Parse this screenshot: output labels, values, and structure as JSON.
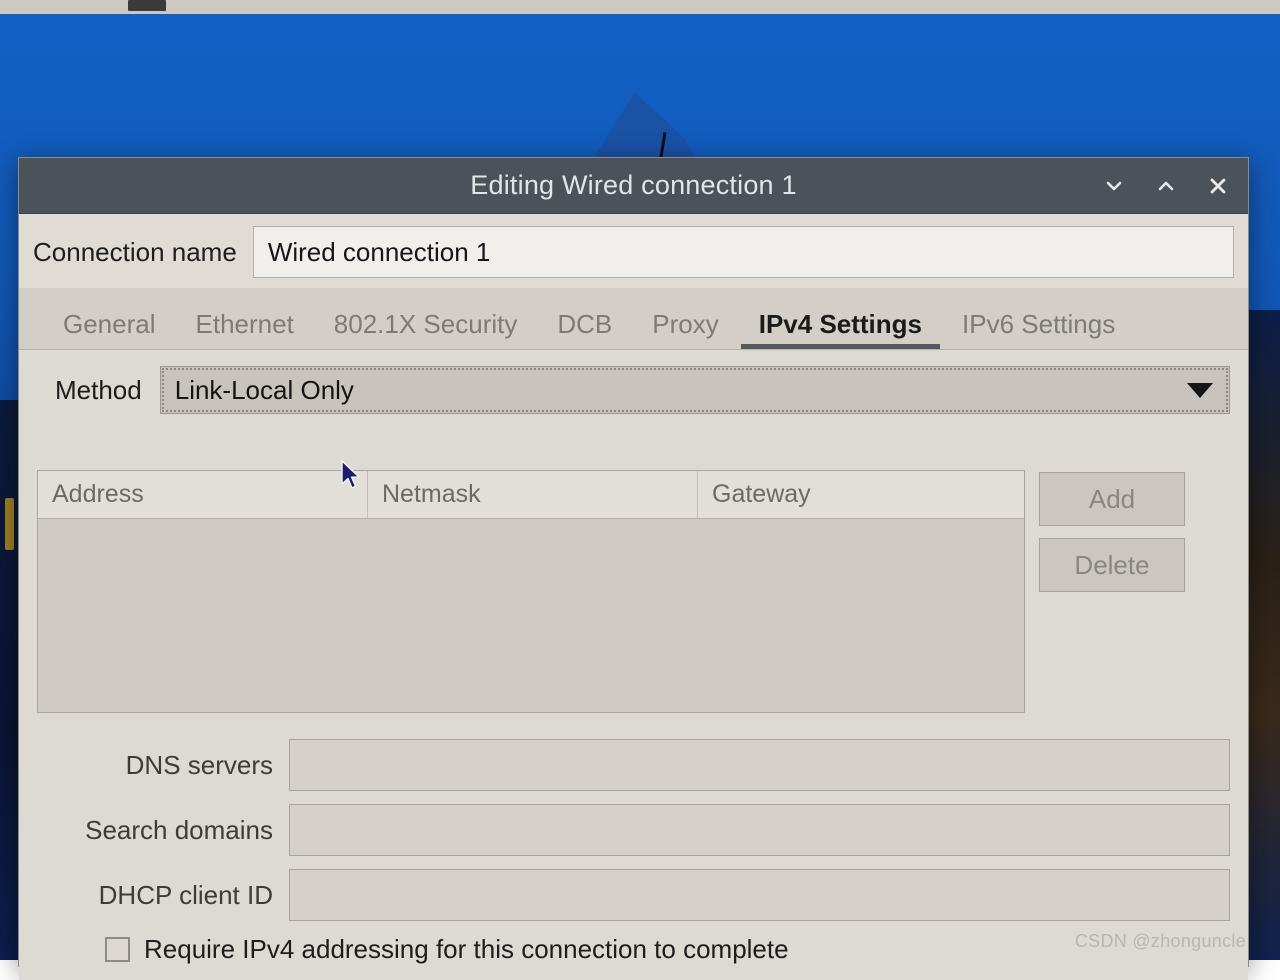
{
  "desktop": {
    "panel_icon_name": "app-icon"
  },
  "window": {
    "title": "Editing Wired connection 1",
    "controls": [
      {
        "name": "minimize-button",
        "icon": "chevron-down-icon"
      },
      {
        "name": "maximize-button",
        "icon": "chevron-up-icon"
      },
      {
        "name": "close-button",
        "icon": "close-icon"
      }
    ]
  },
  "connection": {
    "label": "Connection name",
    "value": "Wired connection 1",
    "placeholder": ""
  },
  "tabs": [
    {
      "label": "General",
      "active": false
    },
    {
      "label": "Ethernet",
      "active": false
    },
    {
      "label": "802.1X Security",
      "active": false
    },
    {
      "label": "DCB",
      "active": false
    },
    {
      "label": "Proxy",
      "active": false
    },
    {
      "label": "IPv4 Settings",
      "active": true
    },
    {
      "label": "IPv6 Settings",
      "active": false
    }
  ],
  "method": {
    "label": "Method",
    "selected": "Link-Local Only",
    "caret_icon": "chevron-down-icon"
  },
  "addresses": {
    "columns": [
      "Address",
      "Netmask",
      "Gateway"
    ],
    "rows": [],
    "add_label": "Add",
    "delete_label": "Delete",
    "add_enabled": false,
    "delete_enabled": false
  },
  "fields": [
    {
      "label": "DNS servers",
      "value": "",
      "name": "dns-servers-input"
    },
    {
      "label": "Search domains",
      "value": "",
      "name": "search-domains-input"
    },
    {
      "label": "DHCP client ID",
      "value": "",
      "name": "dhcp-client-id-input"
    }
  ],
  "require_ipv4": {
    "label": "Require IPv4 addressing for this connection to complete",
    "checked": false
  },
  "watermark": "CSDN @zhonguncle",
  "colors": {
    "titlebar": "#4c525a",
    "dialog_bg": "#dddad3",
    "accent_underline": "#55585c",
    "wallpaper_blue": "#1360c4"
  }
}
